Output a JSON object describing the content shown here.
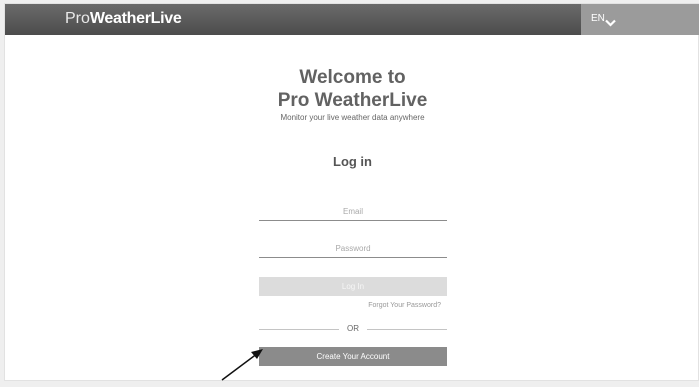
{
  "header": {
    "logo_pro": "Pro",
    "logo_brand": "WeatherLive",
    "language": "EN",
    "background": "#555555",
    "lang_background": "#9b9b9b"
  },
  "welcome": {
    "line1": "Welcome to",
    "line2": "Pro WeatherLive",
    "subtitle": "Monitor your live weather data anywhere"
  },
  "login": {
    "heading": "Log in",
    "email_placeholder": "Email",
    "email_value": "",
    "password_placeholder": "Password",
    "password_value": "",
    "login_button": "Log In",
    "forgot_link": "Forgot Your Password?",
    "divider_text": "OR",
    "create_button": "Create Your Account"
  },
  "icons": {
    "language_chevron": "chevron-down-icon",
    "annotation_arrow": "arrow-icon"
  }
}
